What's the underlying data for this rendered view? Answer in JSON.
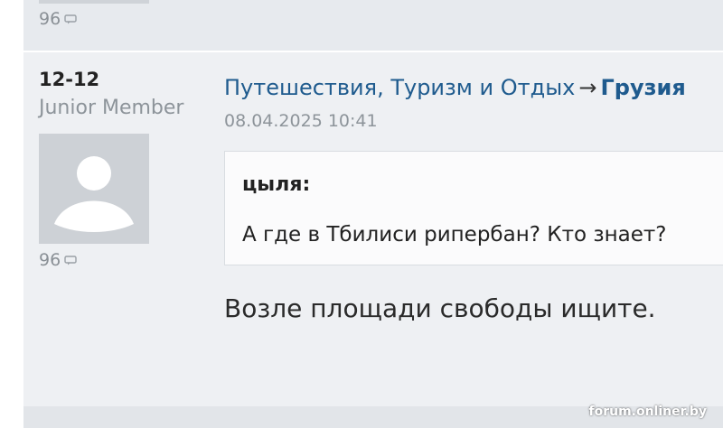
{
  "previous_post": {
    "reply_count": "96"
  },
  "post": {
    "author": {
      "username": "12-12",
      "role": "Junior Member",
      "reply_count": "96"
    },
    "breadcrumb": {
      "section": "Путешествия, Туризм и Отдых",
      "separator": "→",
      "topic": "Грузия"
    },
    "timestamp": "08.04.2025 10:41",
    "quote": {
      "author": "цыля:",
      "text": "А где в Тбилиси рипербан? Кто знает?"
    },
    "message": "Возле площади свободы ищите."
  },
  "watermark": "forum.onliner.by",
  "colors": {
    "link": "#1f5b8e",
    "background": "#e7eaee",
    "post_background": "#eef0f3",
    "muted": "#8d949a"
  }
}
